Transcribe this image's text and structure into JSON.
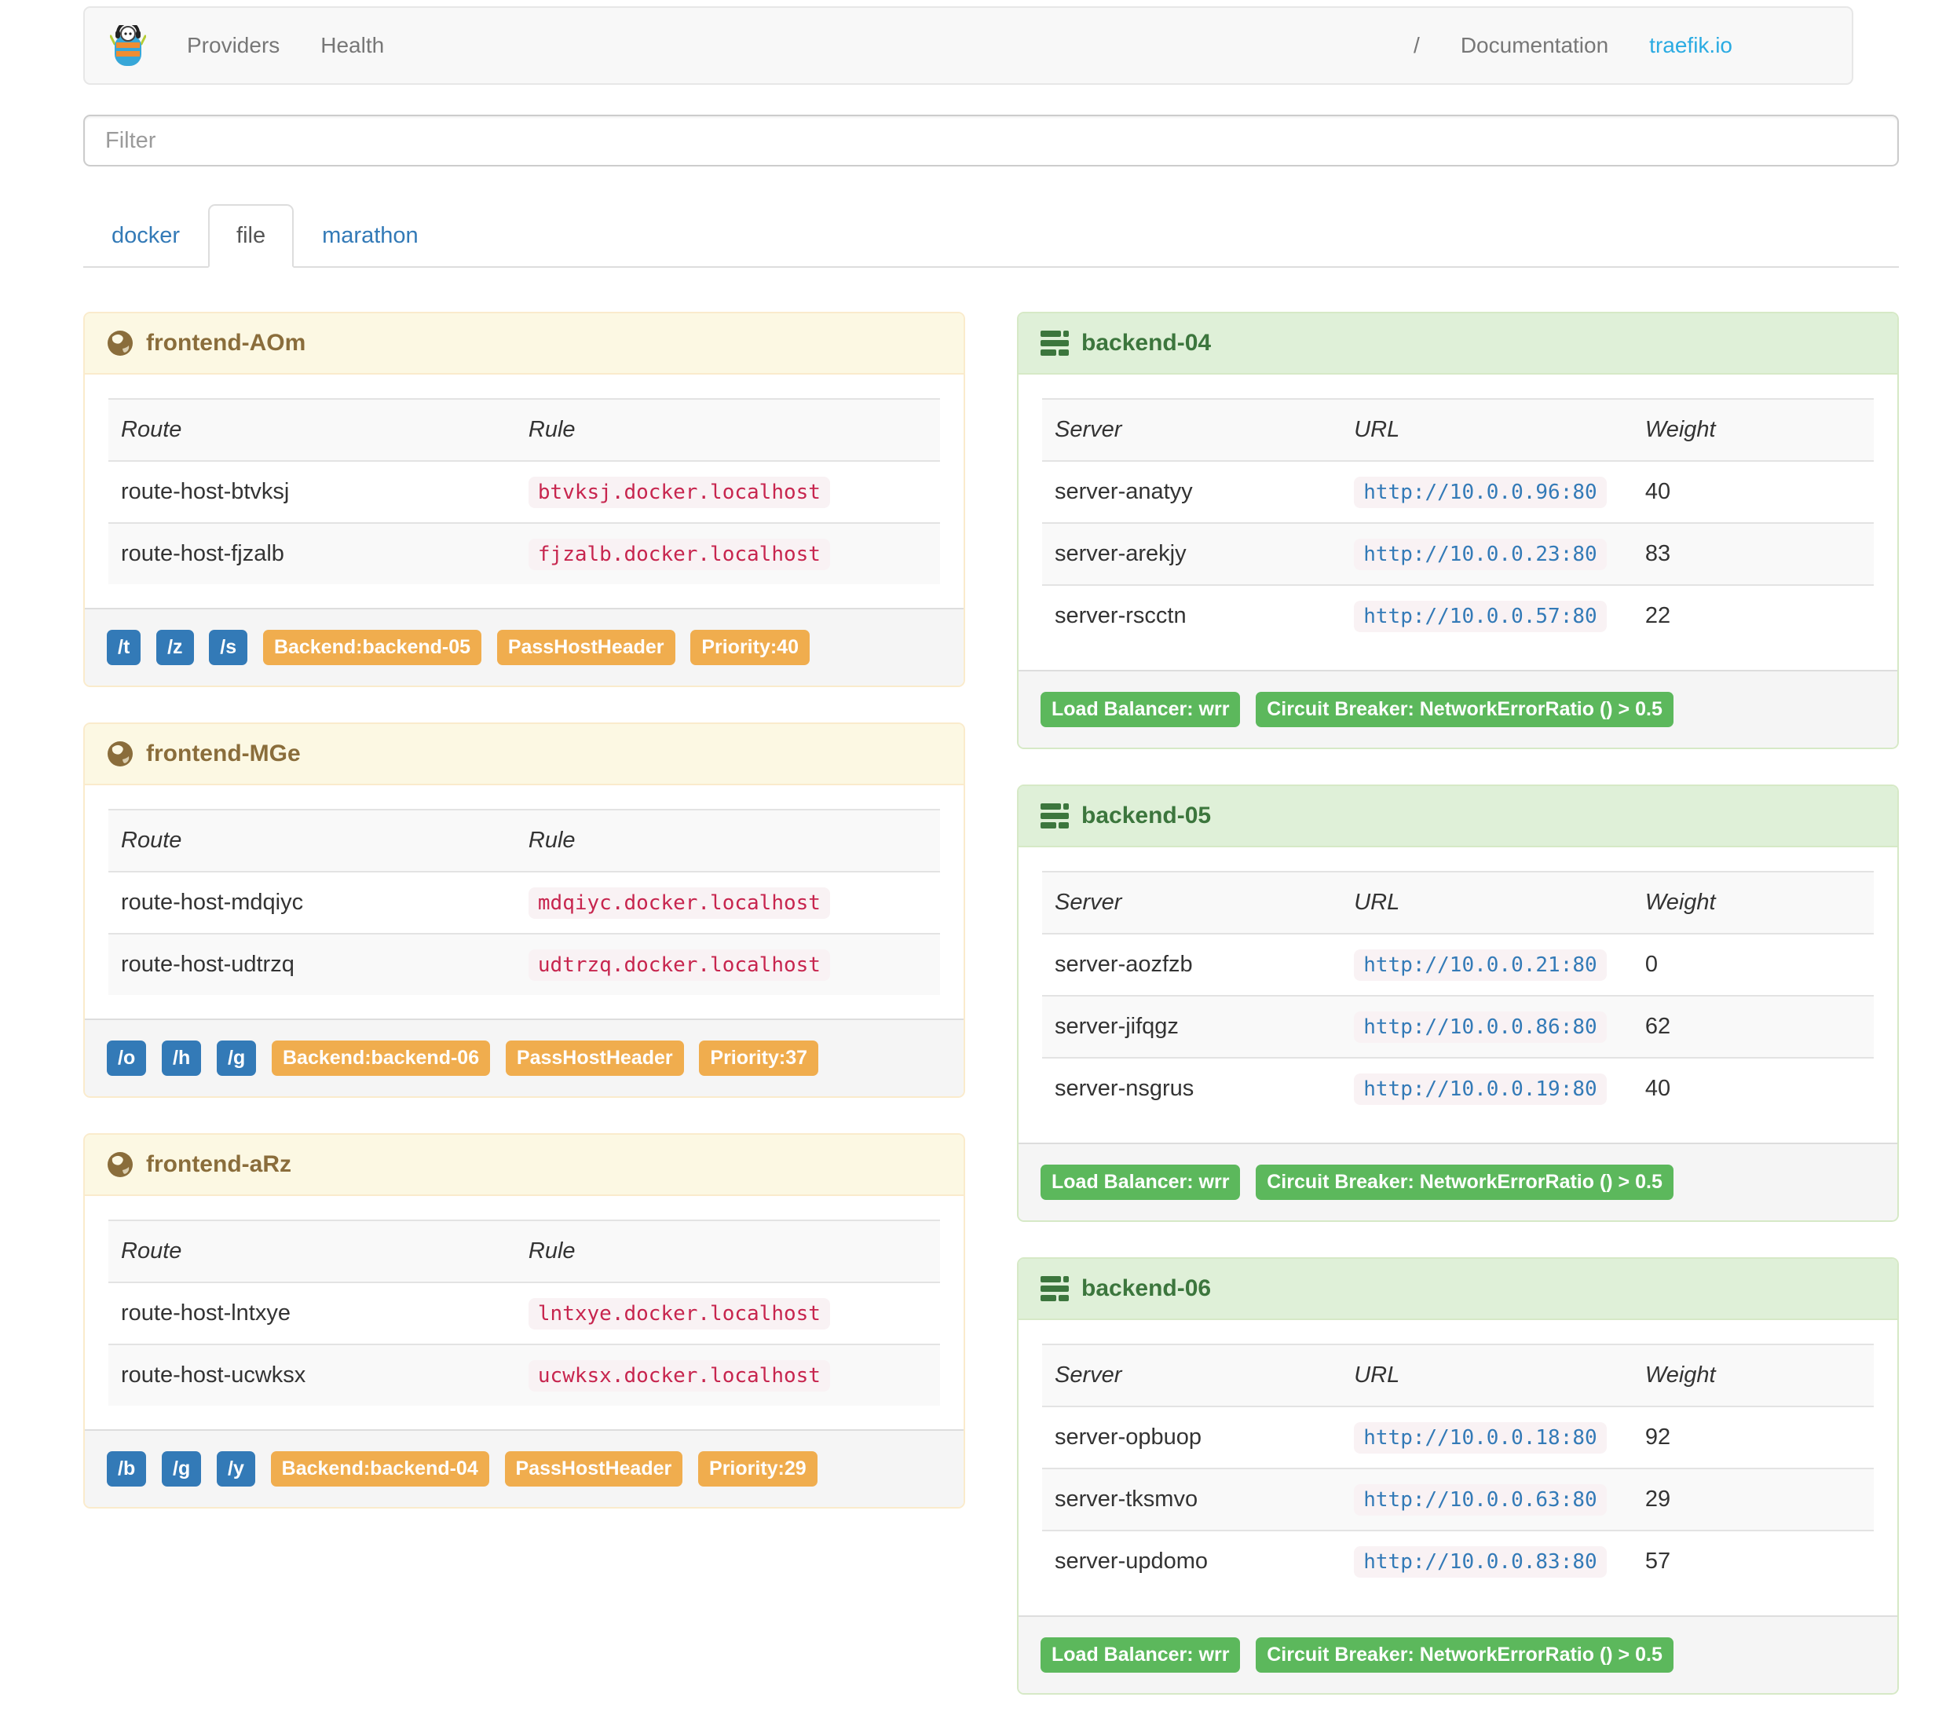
{
  "navbar": {
    "links": [
      {
        "label": "Providers"
      },
      {
        "label": "Health"
      }
    ],
    "divider": "/",
    "doc_link": "Documentation",
    "site_link": "traefik.io"
  },
  "filter": {
    "placeholder": "Filter"
  },
  "tabs": [
    {
      "label": "docker"
    },
    {
      "label": "file"
    },
    {
      "label": "marathon"
    }
  ],
  "active_tab": "file",
  "frontends": [
    {
      "title": "frontend-AOm",
      "columns": {
        "c1": "Route",
        "c2": "Rule"
      },
      "rows": [
        {
          "route": "route-host-btvksj",
          "rule": "btvksj.docker.localhost"
        },
        {
          "route": "route-host-fjzalb",
          "rule": "fjzalb.docker.localhost"
        }
      ],
      "route_badges": [
        "/t",
        "/z",
        "/s"
      ],
      "detail_badges": [
        "Backend:backend-05",
        "PassHostHeader",
        "Priority:40"
      ]
    },
    {
      "title": "frontend-MGe",
      "columns": {
        "c1": "Route",
        "c2": "Rule"
      },
      "rows": [
        {
          "route": "route-host-mdqiyc",
          "rule": "mdqiyc.docker.localhost"
        },
        {
          "route": "route-host-udtrzq",
          "rule": "udtrzq.docker.localhost"
        }
      ],
      "route_badges": [
        "/o",
        "/h",
        "/g"
      ],
      "detail_badges": [
        "Backend:backend-06",
        "PassHostHeader",
        "Priority:37"
      ]
    },
    {
      "title": "frontend-aRz",
      "columns": {
        "c1": "Route",
        "c2": "Rule"
      },
      "rows": [
        {
          "route": "route-host-lntxye",
          "rule": "lntxye.docker.localhost"
        },
        {
          "route": "route-host-ucwksx",
          "rule": "ucwksx.docker.localhost"
        }
      ],
      "route_badges": [
        "/b",
        "/g",
        "/y"
      ],
      "detail_badges": [
        "Backend:backend-04",
        "PassHostHeader",
        "Priority:29"
      ]
    }
  ],
  "backends": [
    {
      "title": "backend-04",
      "columns": {
        "c1": "Server",
        "c2": "URL",
        "c3": "Weight"
      },
      "rows": [
        {
          "server": "server-anatyy",
          "url": "http://10.0.0.96:80",
          "weight": "40"
        },
        {
          "server": "server-arekjy",
          "url": "http://10.0.0.23:80",
          "weight": "83"
        },
        {
          "server": "server-rscctn",
          "url": "http://10.0.0.57:80",
          "weight": "22"
        }
      ],
      "badges": [
        "Load Balancer: wrr",
        "Circuit Breaker: NetworkErrorRatio () > 0.5"
      ]
    },
    {
      "title": "backend-05",
      "columns": {
        "c1": "Server",
        "c2": "URL",
        "c3": "Weight"
      },
      "rows": [
        {
          "server": "server-aozfzb",
          "url": "http://10.0.0.21:80",
          "weight": "0"
        },
        {
          "server": "server-jifqgz",
          "url": "http://10.0.0.86:80",
          "weight": "62"
        },
        {
          "server": "server-nsgrus",
          "url": "http://10.0.0.19:80",
          "weight": "40"
        }
      ],
      "badges": [
        "Load Balancer: wrr",
        "Circuit Breaker: NetworkErrorRatio () > 0.5"
      ]
    },
    {
      "title": "backend-06",
      "columns": {
        "c1": "Server",
        "c2": "URL",
        "c3": "Weight"
      },
      "rows": [
        {
          "server": "server-opbuop",
          "url": "http://10.0.0.18:80",
          "weight": "92"
        },
        {
          "server": "server-tksmvo",
          "url": "http://10.0.0.63:80",
          "weight": "29"
        },
        {
          "server": "server-updomo",
          "url": "http://10.0.0.83:80",
          "weight": "57"
        }
      ],
      "badges": [
        "Load Balancer: wrr",
        "Circuit Breaker: NetworkErrorRatio () > 0.5"
      ]
    }
  ],
  "colors": {
    "link_blue": "#337ab7",
    "brand_blue": "#2aabe2",
    "warning_text": "#8a6d3b",
    "warning_bg": "#fcf8e3",
    "warning_border": "#faebcc",
    "success_text": "#3c763d",
    "success_bg": "#dff0d8",
    "success_border": "#d6e9c6",
    "label_primary": "#337ab7",
    "label_warning": "#f0ad4e",
    "label_success": "#5cb85c",
    "code_rule_text": "#c7254e",
    "code_bg": "#f9f2f4"
  }
}
